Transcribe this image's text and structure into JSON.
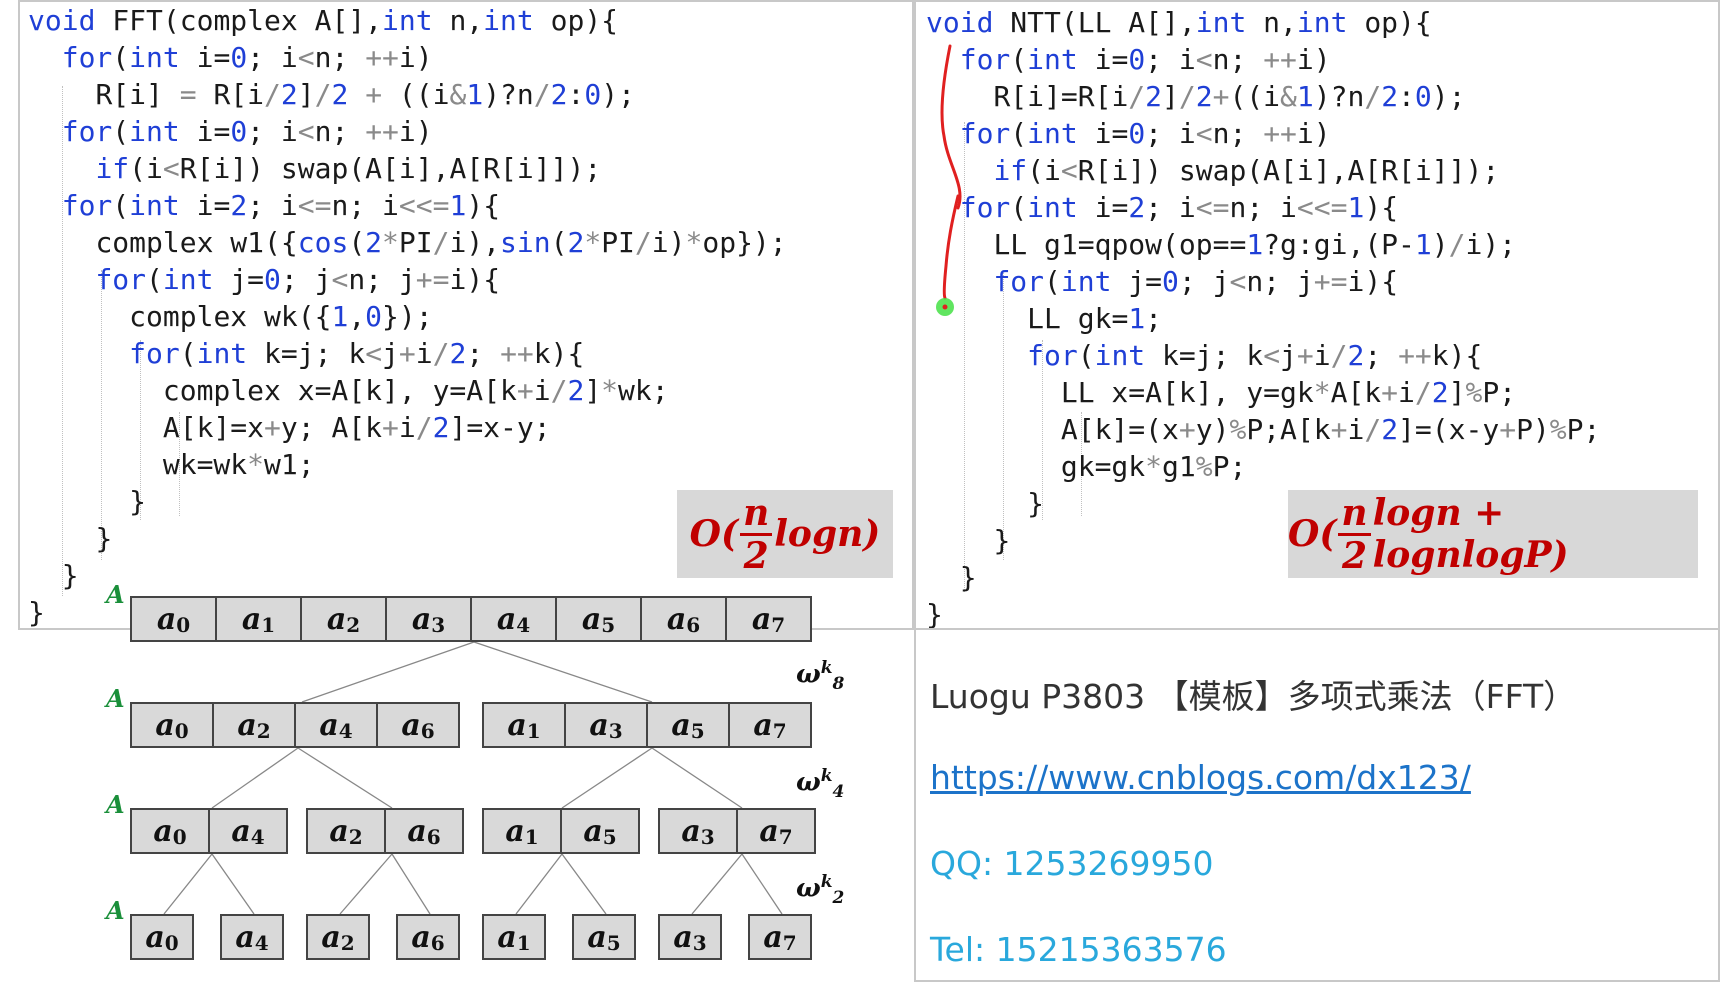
{
  "fft": {
    "lines": [
      {
        "pre": "",
        "tokens": [
          [
            "kw",
            "void"
          ],
          [
            "t",
            " FFT(complex A[],"
          ],
          [
            "kw",
            "int"
          ],
          [
            "t",
            " n,"
          ],
          [
            "kw",
            "int"
          ],
          [
            "t",
            " op){"
          ]
        ]
      },
      {
        "pre": "  ",
        "tokens": [
          [
            "kw",
            "for"
          ],
          [
            "t",
            "("
          ],
          [
            "kw",
            "int"
          ],
          [
            "t",
            " i="
          ],
          [
            "num",
            "0"
          ],
          [
            "t",
            "; i"
          ],
          [
            "op",
            "<"
          ],
          [
            "t",
            "n; "
          ],
          [
            "op",
            "++"
          ],
          [
            "t",
            "i)"
          ]
        ]
      },
      {
        "pre": "    ",
        "tokens": [
          [
            "t",
            "R[i] "
          ],
          [
            "op",
            "="
          ],
          [
            "t",
            " R[i"
          ],
          [
            "op",
            "/"
          ],
          [
            "num",
            "2"
          ],
          [
            "t",
            "]"
          ],
          [
            "op",
            "/"
          ],
          [
            "num",
            "2"
          ],
          [
            "t",
            " "
          ],
          [
            "op",
            "+"
          ],
          [
            "t",
            " ((i"
          ],
          [
            "op",
            "&"
          ],
          [
            "num",
            "1"
          ],
          [
            "t",
            ")?n"
          ],
          [
            "op",
            "/"
          ],
          [
            "num",
            "2"
          ],
          [
            "t",
            ":"
          ],
          [
            "num",
            "0"
          ],
          [
            "t",
            ");"
          ]
        ]
      },
      {
        "pre": "  ",
        "tokens": [
          [
            "kw",
            "for"
          ],
          [
            "t",
            "("
          ],
          [
            "kw",
            "int"
          ],
          [
            "t",
            " i="
          ],
          [
            "num",
            "0"
          ],
          [
            "t",
            "; i"
          ],
          [
            "op",
            "<"
          ],
          [
            "t",
            "n; "
          ],
          [
            "op",
            "++"
          ],
          [
            "t",
            "i)"
          ]
        ]
      },
      {
        "pre": "    ",
        "tokens": [
          [
            "kw",
            "if"
          ],
          [
            "t",
            "(i"
          ],
          [
            "op",
            "<"
          ],
          [
            "t",
            "R[i]) swap(A[i],A[R[i]]);"
          ]
        ]
      },
      {
        "pre": "  ",
        "tokens": [
          [
            "kw",
            "for"
          ],
          [
            "t",
            "("
          ],
          [
            "kw",
            "int"
          ],
          [
            "t",
            " i="
          ],
          [
            "num",
            "2"
          ],
          [
            "t",
            "; i"
          ],
          [
            "op",
            "<="
          ],
          [
            "t",
            "n; i"
          ],
          [
            "op",
            "<<="
          ],
          [
            "num",
            "1"
          ],
          [
            "t",
            "){"
          ]
        ]
      },
      {
        "pre": "    ",
        "tokens": [
          [
            "t",
            "complex w1({"
          ],
          [
            "kw",
            "cos"
          ],
          [
            "t",
            "("
          ],
          [
            "num",
            "2"
          ],
          [
            "op",
            "*"
          ],
          [
            "t",
            "PI"
          ],
          [
            "op",
            "/"
          ],
          [
            "t",
            "i),"
          ],
          [
            "kw",
            "sin"
          ],
          [
            "t",
            "("
          ],
          [
            "num",
            "2"
          ],
          [
            "op",
            "*"
          ],
          [
            "t",
            "PI"
          ],
          [
            "op",
            "/"
          ],
          [
            "t",
            "i)"
          ],
          [
            "op",
            "*"
          ],
          [
            "t",
            "op});"
          ]
        ]
      },
      {
        "pre": "    ",
        "tokens": [
          [
            "kw",
            "for"
          ],
          [
            "t",
            "("
          ],
          [
            "kw",
            "int"
          ],
          [
            "t",
            " j="
          ],
          [
            "num",
            "0"
          ],
          [
            "t",
            "; j"
          ],
          [
            "op",
            "<"
          ],
          [
            "t",
            "n; j"
          ],
          [
            "op",
            "+="
          ],
          [
            "t",
            "i){"
          ]
        ]
      },
      {
        "pre": "      ",
        "tokens": [
          [
            "t",
            "complex wk({"
          ],
          [
            "num",
            "1"
          ],
          [
            "t",
            ","
          ],
          [
            "num",
            "0"
          ],
          [
            "t",
            "});"
          ]
        ]
      },
      {
        "pre": "      ",
        "tokens": [
          [
            "kw",
            "for"
          ],
          [
            "t",
            "("
          ],
          [
            "kw",
            "int"
          ],
          [
            "t",
            " k=j; k"
          ],
          [
            "op",
            "<"
          ],
          [
            "t",
            "j"
          ],
          [
            "op",
            "+"
          ],
          [
            "t",
            "i"
          ],
          [
            "op",
            "/"
          ],
          [
            "num",
            "2"
          ],
          [
            "t",
            "; "
          ],
          [
            "op",
            "++"
          ],
          [
            "t",
            "k){"
          ]
        ]
      },
      {
        "pre": "        ",
        "tokens": [
          [
            "t",
            "complex x=A[k], y=A[k"
          ],
          [
            "op",
            "+"
          ],
          [
            "t",
            "i"
          ],
          [
            "op",
            "/"
          ],
          [
            "num",
            "2"
          ],
          [
            "t",
            "]"
          ],
          [
            "op",
            "*"
          ],
          [
            "t",
            "wk;"
          ]
        ]
      },
      {
        "pre": "        ",
        "tokens": [
          [
            "t",
            "A[k]=x"
          ],
          [
            "op",
            "+"
          ],
          [
            "t",
            "y; A[k"
          ],
          [
            "op",
            "+"
          ],
          [
            "t",
            "i"
          ],
          [
            "op",
            "/"
          ],
          [
            "num",
            "2"
          ],
          [
            "t",
            "]=x-y;"
          ]
        ]
      },
      {
        "pre": "        ",
        "tokens": [
          [
            "t",
            "wk=wk"
          ],
          [
            "op",
            "*"
          ],
          [
            "t",
            "w1;"
          ]
        ]
      },
      {
        "pre": "      ",
        "tokens": [
          [
            "t",
            "}"
          ]
        ]
      },
      {
        "pre": "    ",
        "tokens": [
          [
            "t",
            "}"
          ]
        ]
      },
      {
        "pre": "  ",
        "tokens": [
          [
            "t",
            "}"
          ]
        ]
      },
      {
        "pre": "",
        "tokens": [
          [
            "t",
            "}"
          ]
        ]
      }
    ],
    "complexity": {
      "O": "O(",
      "n": "n",
      "d": "2",
      "rest": "logn)"
    }
  },
  "ntt": {
    "lines": [
      {
        "pre": "",
        "tokens": [
          [
            "kw",
            "void"
          ],
          [
            "t",
            " NTT(LL A[],"
          ],
          [
            "kw",
            "int"
          ],
          [
            "t",
            " n,"
          ],
          [
            "kw",
            "int"
          ],
          [
            "t",
            " op){"
          ]
        ]
      },
      {
        "pre": "  ",
        "tokens": [
          [
            "kw",
            "for"
          ],
          [
            "t",
            "("
          ],
          [
            "kw",
            "int"
          ],
          [
            "t",
            " i="
          ],
          [
            "num",
            "0"
          ],
          [
            "t",
            "; i"
          ],
          [
            "op",
            "<"
          ],
          [
            "t",
            "n; "
          ],
          [
            "op",
            "++"
          ],
          [
            "t",
            "i)"
          ]
        ]
      },
      {
        "pre": "    ",
        "tokens": [
          [
            "t",
            "R[i]=R[i"
          ],
          [
            "op",
            "/"
          ],
          [
            "num",
            "2"
          ],
          [
            "t",
            "]"
          ],
          [
            "op",
            "/"
          ],
          [
            "num",
            "2"
          ],
          [
            "op",
            "+"
          ],
          [
            "t",
            "((i"
          ],
          [
            "op",
            "&"
          ],
          [
            "num",
            "1"
          ],
          [
            "t",
            ")?n"
          ],
          [
            "op",
            "/"
          ],
          [
            "num",
            "2"
          ],
          [
            "t",
            ":"
          ],
          [
            "num",
            "0"
          ],
          [
            "t",
            ");"
          ]
        ]
      },
      {
        "pre": "  ",
        "tokens": [
          [
            "kw",
            "for"
          ],
          [
            "t",
            "("
          ],
          [
            "kw",
            "int"
          ],
          [
            "t",
            " i="
          ],
          [
            "num",
            "0"
          ],
          [
            "t",
            "; i"
          ],
          [
            "op",
            "<"
          ],
          [
            "t",
            "n; "
          ],
          [
            "op",
            "++"
          ],
          [
            "t",
            "i)"
          ]
        ]
      },
      {
        "pre": "    ",
        "tokens": [
          [
            "kw",
            "if"
          ],
          [
            "t",
            "(i"
          ],
          [
            "op",
            "<"
          ],
          [
            "t",
            "R[i]) swap(A[i],A[R[i]]);"
          ]
        ]
      },
      {
        "pre": "  ",
        "tokens": [
          [
            "kw",
            "for"
          ],
          [
            "t",
            "("
          ],
          [
            "kw",
            "int"
          ],
          [
            "t",
            " i="
          ],
          [
            "num",
            "2"
          ],
          [
            "t",
            "; i"
          ],
          [
            "op",
            "<="
          ],
          [
            "t",
            "n; i"
          ],
          [
            "op",
            "<<="
          ],
          [
            "num",
            "1"
          ],
          [
            "t",
            "){"
          ]
        ]
      },
      {
        "pre": "    ",
        "tokens": [
          [
            "t",
            "LL g1=qpow(op=="
          ],
          [
            "num",
            "1"
          ],
          [
            "t",
            "?g:gi,(P-"
          ],
          [
            "num",
            "1"
          ],
          [
            "t",
            ")"
          ],
          [
            "op",
            "/"
          ],
          [
            "t",
            "i);"
          ]
        ]
      },
      {
        "pre": "    ",
        "tokens": [
          [
            "kw",
            "for"
          ],
          [
            "t",
            "("
          ],
          [
            "kw",
            "int"
          ],
          [
            "t",
            " j="
          ],
          [
            "num",
            "0"
          ],
          [
            "t",
            "; j"
          ],
          [
            "op",
            "<"
          ],
          [
            "t",
            "n; j"
          ],
          [
            "op",
            "+="
          ],
          [
            "t",
            "i){"
          ]
        ]
      },
      {
        "pre": "      ",
        "tokens": [
          [
            "t",
            "LL gk="
          ],
          [
            "num",
            "1"
          ],
          [
            "t",
            ";"
          ]
        ]
      },
      {
        "pre": "      ",
        "tokens": [
          [
            "kw",
            "for"
          ],
          [
            "t",
            "("
          ],
          [
            "kw",
            "int"
          ],
          [
            "t",
            " k=j; k"
          ],
          [
            "op",
            "<"
          ],
          [
            "t",
            "j"
          ],
          [
            "op",
            "+"
          ],
          [
            "t",
            "i"
          ],
          [
            "op",
            "/"
          ],
          [
            "num",
            "2"
          ],
          [
            "t",
            "; "
          ],
          [
            "op",
            "++"
          ],
          [
            "t",
            "k){"
          ]
        ]
      },
      {
        "pre": "        ",
        "tokens": [
          [
            "t",
            "LL x=A[k], y=gk"
          ],
          [
            "op",
            "*"
          ],
          [
            "t",
            "A[k"
          ],
          [
            "op",
            "+"
          ],
          [
            "t",
            "i"
          ],
          [
            "op",
            "/"
          ],
          [
            "num",
            "2"
          ],
          [
            "t",
            "]"
          ],
          [
            "op",
            "%"
          ],
          [
            "t",
            "P;"
          ]
        ]
      },
      {
        "pre": "        ",
        "tokens": [
          [
            "t",
            "A[k]=(x"
          ],
          [
            "op",
            "+"
          ],
          [
            "t",
            "y)"
          ],
          [
            "op",
            "%"
          ],
          [
            "t",
            "P;A[k"
          ],
          [
            "op",
            "+"
          ],
          [
            "t",
            "i"
          ],
          [
            "op",
            "/"
          ],
          [
            "num",
            "2"
          ],
          [
            "t",
            "]=(x-y"
          ],
          [
            "op",
            "+"
          ],
          [
            "t",
            "P)"
          ],
          [
            "op",
            "%"
          ],
          [
            "t",
            "P;"
          ]
        ]
      },
      {
        "pre": "        ",
        "tokens": [
          [
            "t",
            "gk=gk"
          ],
          [
            "op",
            "*"
          ],
          [
            "t",
            "g1"
          ],
          [
            "op",
            "%"
          ],
          [
            "t",
            "P;"
          ]
        ]
      },
      {
        "pre": "      ",
        "tokens": [
          [
            "t",
            "}"
          ]
        ]
      },
      {
        "pre": "    ",
        "tokens": [
          [
            "t",
            "}"
          ]
        ]
      },
      {
        "pre": "  ",
        "tokens": [
          [
            "t",
            "}"
          ]
        ]
      },
      {
        "pre": "",
        "tokens": [
          [
            "t",
            "}"
          ]
        ]
      }
    ],
    "complexity": {
      "O": "O(",
      "n": "n",
      "d": "2",
      "rest": "logn + lognlogP)"
    }
  },
  "diagram": {
    "array_label": "A",
    "row1": [
      "0",
      "1",
      "2",
      "3",
      "4",
      "5",
      "6",
      "7"
    ],
    "row2": [
      [
        "0",
        "2",
        "4",
        "6"
      ],
      [
        "1",
        "3",
        "5",
        "7"
      ]
    ],
    "row3": [
      [
        "0",
        "4"
      ],
      [
        "2",
        "6"
      ],
      [
        "1",
        "5"
      ],
      [
        "3",
        "7"
      ]
    ],
    "row4": [
      "0",
      "4",
      "2",
      "6",
      "1",
      "5",
      "3",
      "7"
    ],
    "cell_letter": "a",
    "omegas": [
      {
        "base": "ω",
        "sub": "8",
        "sup": "k"
      },
      {
        "base": "ω",
        "sub": "4",
        "sup": "k"
      },
      {
        "base": "ω",
        "sub": "2",
        "sup": "k"
      }
    ]
  },
  "info": {
    "title": "Luogu P3803 【模板】多项式乘法（FFT）",
    "link": "https://www.cnblogs.com/dx123/",
    "qq": "QQ: 1253269950",
    "tel": "Tel: 15215363576"
  },
  "colors": {
    "keyword": "#1f3fd6",
    "complexity": "#c00000",
    "a_label": "#1a8f3a",
    "link": "#1c73c9",
    "contact": "#29a8dc"
  }
}
